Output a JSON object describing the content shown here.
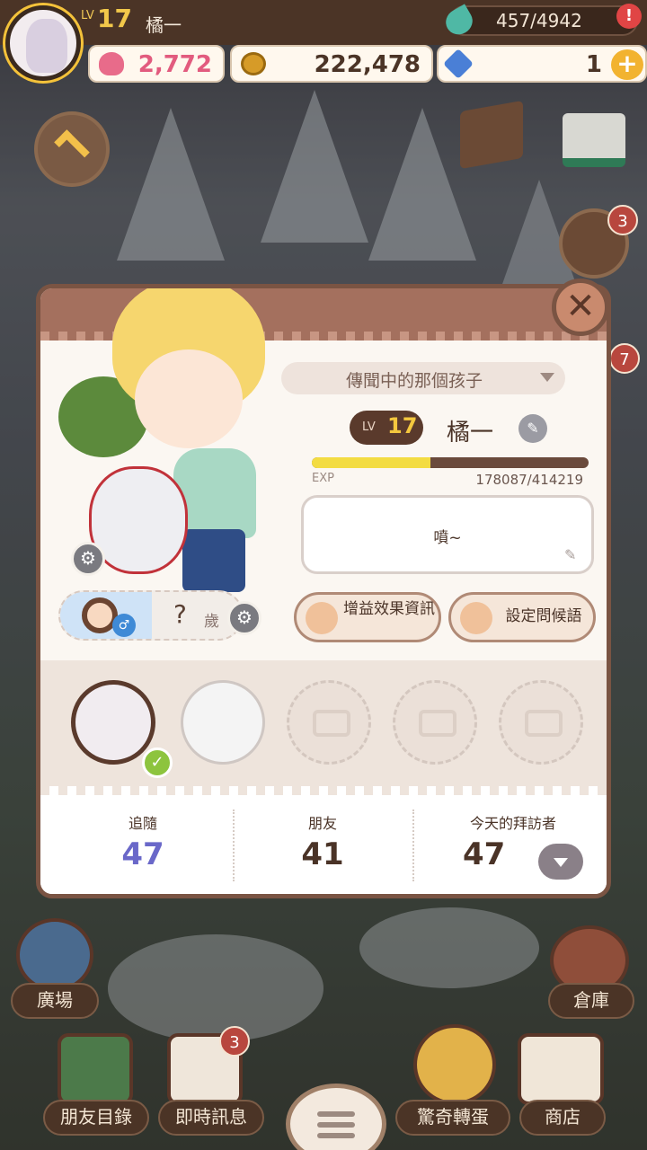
{
  "top": {
    "level_label": "LV",
    "level": "17",
    "username": "橘一",
    "energy": "457/4942",
    "alert": "!"
  },
  "currency": {
    "hearts": "2,772",
    "coins": "222,478",
    "gems": "1",
    "plus": "+"
  },
  "badges": {
    "right_upper": "3",
    "right_lower": "7",
    "messages": "3"
  },
  "profile": {
    "close": "✕",
    "title": "傳聞中的那個孩子",
    "lv_label": "LV",
    "level": "17",
    "name": "橘一",
    "exp_label": "EXP",
    "exp": "178087/414219",
    "exp_progress": 0.43,
    "greeting": "噴~",
    "age": "?",
    "age_unit": "歲",
    "buff_button": "增益效果資訊",
    "greeting_button": "設定問候語",
    "stats": {
      "follow_label": "追隨",
      "follow": "47",
      "friends_label": "朋友",
      "friends": "41",
      "visitors_label": "今天的拜訪者",
      "visitors": "47"
    }
  },
  "nav": {
    "plaza": "廣場",
    "warehouse": "倉庫",
    "friends_list": "朋友目錄",
    "messages": "即時訊息",
    "gacha": "驚奇轉蛋",
    "shop": "商店"
  },
  "colors": {
    "header_brown": "#4b3426",
    "modal_border": "#7a5443",
    "follow_accent": "#6a68c9",
    "gold": "#f4c83e"
  }
}
